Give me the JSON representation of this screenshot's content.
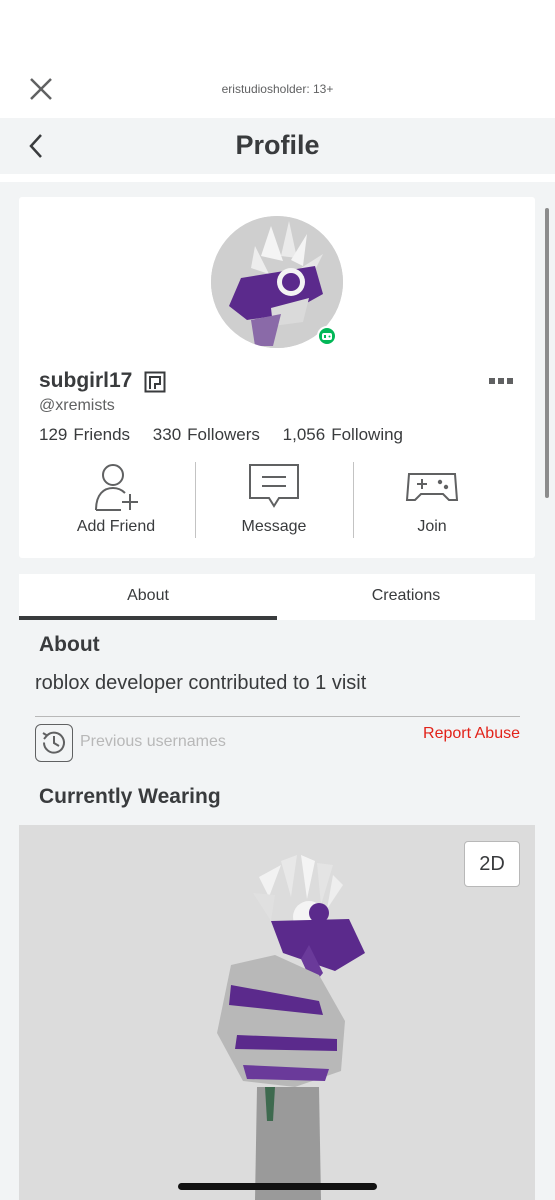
{
  "topbar": {
    "account_label": "eristudiosholder: 13+"
  },
  "header": {
    "title": "Profile"
  },
  "profile": {
    "display_name": "subgirl17",
    "username": "@xremists",
    "stats": [
      {
        "value": "129",
        "label": "Friends"
      },
      {
        "value": "330",
        "label": "Followers"
      },
      {
        "value": "1,056",
        "label": "Following"
      }
    ],
    "actions": [
      {
        "label": "Add Friend",
        "icon": "add-friend-icon"
      },
      {
        "label": "Message",
        "icon": "message-icon"
      },
      {
        "label": "Join",
        "icon": "gamepad-icon"
      }
    ]
  },
  "tabs": [
    {
      "label": "About",
      "active": true
    },
    {
      "label": "Creations",
      "active": false
    }
  ],
  "about": {
    "heading": "About",
    "text": "roblox developer contributed to 1 visit",
    "previous_usernames_label": "Previous usernames",
    "report_label": "Report Abuse"
  },
  "wearing": {
    "heading": "Currently Wearing",
    "toggle_label": "2D"
  },
  "colors": {
    "background": "#f2f4f5",
    "card": "#ffffff",
    "text": "#393b3d",
    "presence_online": "#02b757",
    "report": "#e2231a",
    "avatar_accent": "#5b2a8c"
  }
}
